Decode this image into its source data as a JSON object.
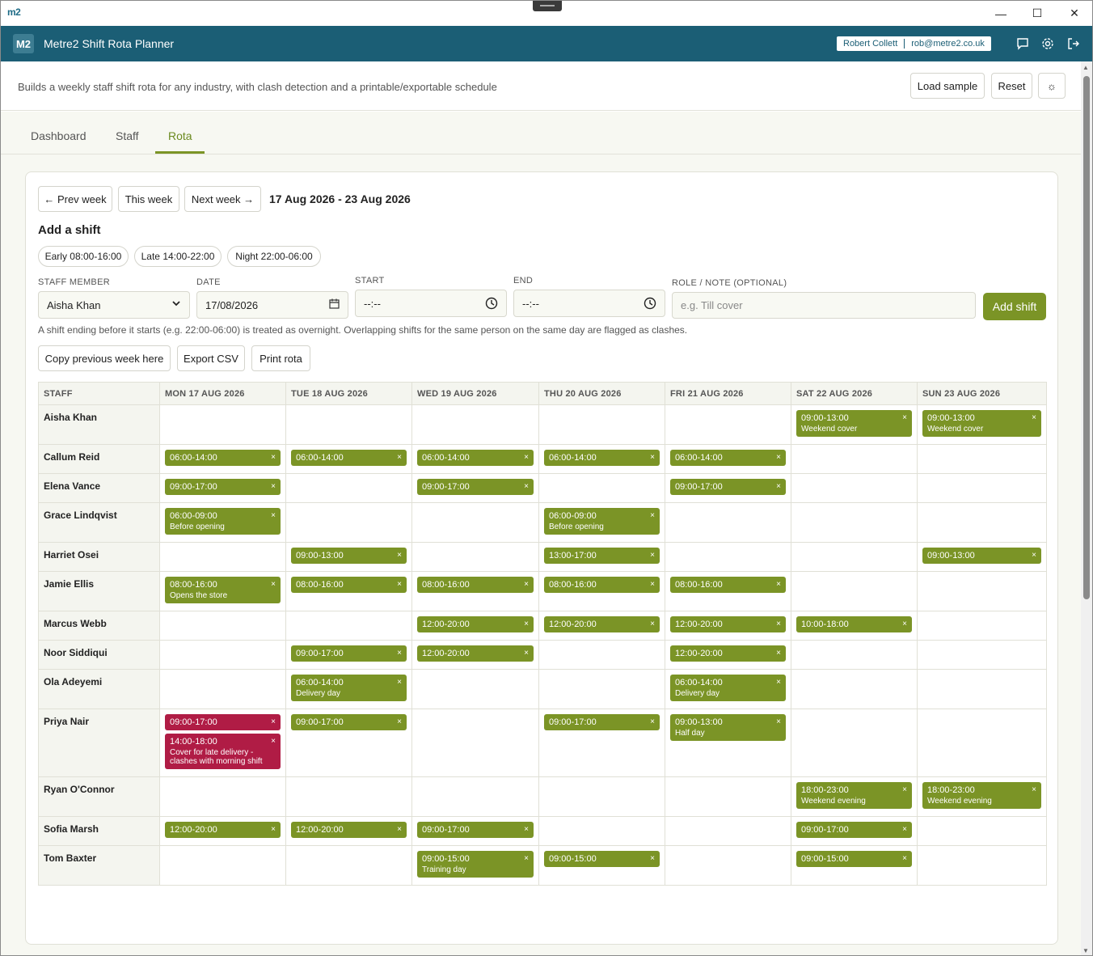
{
  "titlebar": {
    "logo": "m2",
    "minimize": "—",
    "maximize": "☐",
    "close": "✕"
  },
  "app": {
    "logo": "M2",
    "title": "Metre2 Shift Rota Planner",
    "user_name": "Robert Collett",
    "user_email": "rob@metre2.co.uk"
  },
  "description": "Builds a weekly staff shift rota for any industry, with clash detection and a printable/exportable schedule",
  "header_buttons": {
    "load_sample": "Load sample",
    "reset": "Reset",
    "theme": "☼"
  },
  "tabs": [
    {
      "label": "Dashboard"
    },
    {
      "label": "Staff"
    },
    {
      "label": "Rota"
    }
  ],
  "week_nav": {
    "prev": "← Prev week",
    "this": "This week",
    "next": "Next week →",
    "range": "17 Aug 2026 - 23 Aug 2026"
  },
  "add_shift": {
    "heading": "Add a shift",
    "presets": [
      "Early 08:00-16:00",
      "Late 14:00-22:00",
      "Night 22:00-06:00"
    ],
    "labels": {
      "staff": "STAFF MEMBER",
      "date": "DATE",
      "start": "START",
      "end": "END",
      "role": "ROLE / NOTE (OPTIONAL)"
    },
    "staff_value": "Aisha Khan",
    "date_value": "17/08/2026",
    "start_value": "--:--",
    "end_value": "--:--",
    "role_placeholder": "e.g. Till cover",
    "submit": "Add shift",
    "hint": "A shift ending before it starts (e.g. 22:00-06:00) is treated as overnight. Overlapping shifts for the same person on the same day are flagged as clashes."
  },
  "actions": {
    "copy": "Copy previous week here",
    "export": "Export CSV",
    "print": "Print rota"
  },
  "rota": {
    "columns": [
      "STAFF",
      "MON 17 AUG 2026",
      "TUE 18 AUG 2026",
      "WED 19 AUG 2026",
      "THU 20 AUG 2026",
      "FRI 21 AUG 2026",
      "SAT 22 AUG 2026",
      "SUN 23 AUG 2026"
    ],
    "remove_glyph": "×",
    "rows": [
      {
        "name": "Aisha Khan",
        "days": [
          [],
          [],
          [],
          [],
          [],
          [
            {
              "time": "09:00-13:00",
              "note": "Weekend cover"
            }
          ],
          [
            {
              "time": "09:00-13:00",
              "note": "Weekend cover"
            }
          ]
        ]
      },
      {
        "name": "Callum Reid",
        "days": [
          [
            {
              "time": "06:00-14:00"
            }
          ],
          [
            {
              "time": "06:00-14:00"
            }
          ],
          [
            {
              "time": "06:00-14:00"
            }
          ],
          [
            {
              "time": "06:00-14:00"
            }
          ],
          [
            {
              "time": "06:00-14:00"
            }
          ],
          [],
          []
        ]
      },
      {
        "name": "Elena Vance",
        "days": [
          [
            {
              "time": "09:00-17:00"
            }
          ],
          [],
          [
            {
              "time": "09:00-17:00"
            }
          ],
          [],
          [
            {
              "time": "09:00-17:00"
            }
          ],
          [],
          []
        ]
      },
      {
        "name": "Grace Lindqvist",
        "days": [
          [
            {
              "time": "06:00-09:00",
              "note": "Before opening"
            }
          ],
          [],
          [],
          [
            {
              "time": "06:00-09:00",
              "note": "Before opening"
            }
          ],
          [],
          [],
          []
        ]
      },
      {
        "name": "Harriet Osei",
        "days": [
          [],
          [
            {
              "time": "09:00-13:00"
            }
          ],
          [],
          [
            {
              "time": "13:00-17:00"
            }
          ],
          [],
          [],
          [
            {
              "time": "09:00-13:00"
            }
          ]
        ]
      },
      {
        "name": "Jamie Ellis",
        "days": [
          [
            {
              "time": "08:00-16:00",
              "note": "Opens the store"
            }
          ],
          [
            {
              "time": "08:00-16:00"
            }
          ],
          [
            {
              "time": "08:00-16:00"
            }
          ],
          [
            {
              "time": "08:00-16:00"
            }
          ],
          [
            {
              "time": "08:00-16:00"
            }
          ],
          [],
          []
        ]
      },
      {
        "name": "Marcus Webb",
        "days": [
          [],
          [],
          [
            {
              "time": "12:00-20:00"
            }
          ],
          [
            {
              "time": "12:00-20:00"
            }
          ],
          [
            {
              "time": "12:00-20:00"
            }
          ],
          [
            {
              "time": "10:00-18:00"
            }
          ],
          []
        ]
      },
      {
        "name": "Noor Siddiqui",
        "days": [
          [],
          [
            {
              "time": "09:00-17:00"
            }
          ],
          [
            {
              "time": "12:00-20:00"
            }
          ],
          [],
          [
            {
              "time": "12:00-20:00"
            }
          ],
          [],
          []
        ]
      },
      {
        "name": "Ola Adeyemi",
        "days": [
          [],
          [
            {
              "time": "06:00-14:00",
              "note": "Delivery day"
            }
          ],
          [],
          [],
          [
            {
              "time": "06:00-14:00",
              "note": "Delivery day"
            }
          ],
          [],
          []
        ]
      },
      {
        "name": "Priya Nair",
        "days": [
          [
            {
              "time": "09:00-17:00",
              "clash": true
            },
            {
              "time": "14:00-18:00",
              "note": "Cover for late delivery - clashes with morning shift",
              "clash": true
            }
          ],
          [
            {
              "time": "09:00-17:00"
            }
          ],
          [],
          [
            {
              "time": "09:00-17:00"
            }
          ],
          [
            {
              "time": "09:00-13:00",
              "note": "Half day"
            }
          ],
          [],
          []
        ]
      },
      {
        "name": "Ryan O'Connor",
        "days": [
          [],
          [],
          [],
          [],
          [],
          [
            {
              "time": "18:00-23:00",
              "note": "Weekend evening"
            }
          ],
          [
            {
              "time": "18:00-23:00",
              "note": "Weekend evening"
            }
          ]
        ]
      },
      {
        "name": "Sofia Marsh",
        "days": [
          [
            {
              "time": "12:00-20:00"
            }
          ],
          [
            {
              "time": "12:00-20:00"
            }
          ],
          [
            {
              "time": "09:00-17:00"
            }
          ],
          [],
          [],
          [
            {
              "time": "09:00-17:00"
            }
          ],
          []
        ]
      },
      {
        "name": "Tom Baxter",
        "days": [
          [],
          [],
          [
            {
              "time": "09:00-15:00",
              "note": "Training day"
            }
          ],
          [
            {
              "time": "09:00-15:00"
            }
          ],
          [],
          [
            {
              "time": "09:00-15:00"
            }
          ],
          []
        ]
      }
    ]
  },
  "colors": {
    "appbar": "#1b5e75",
    "accent": "#7b9426",
    "clash": "#b01c45"
  }
}
